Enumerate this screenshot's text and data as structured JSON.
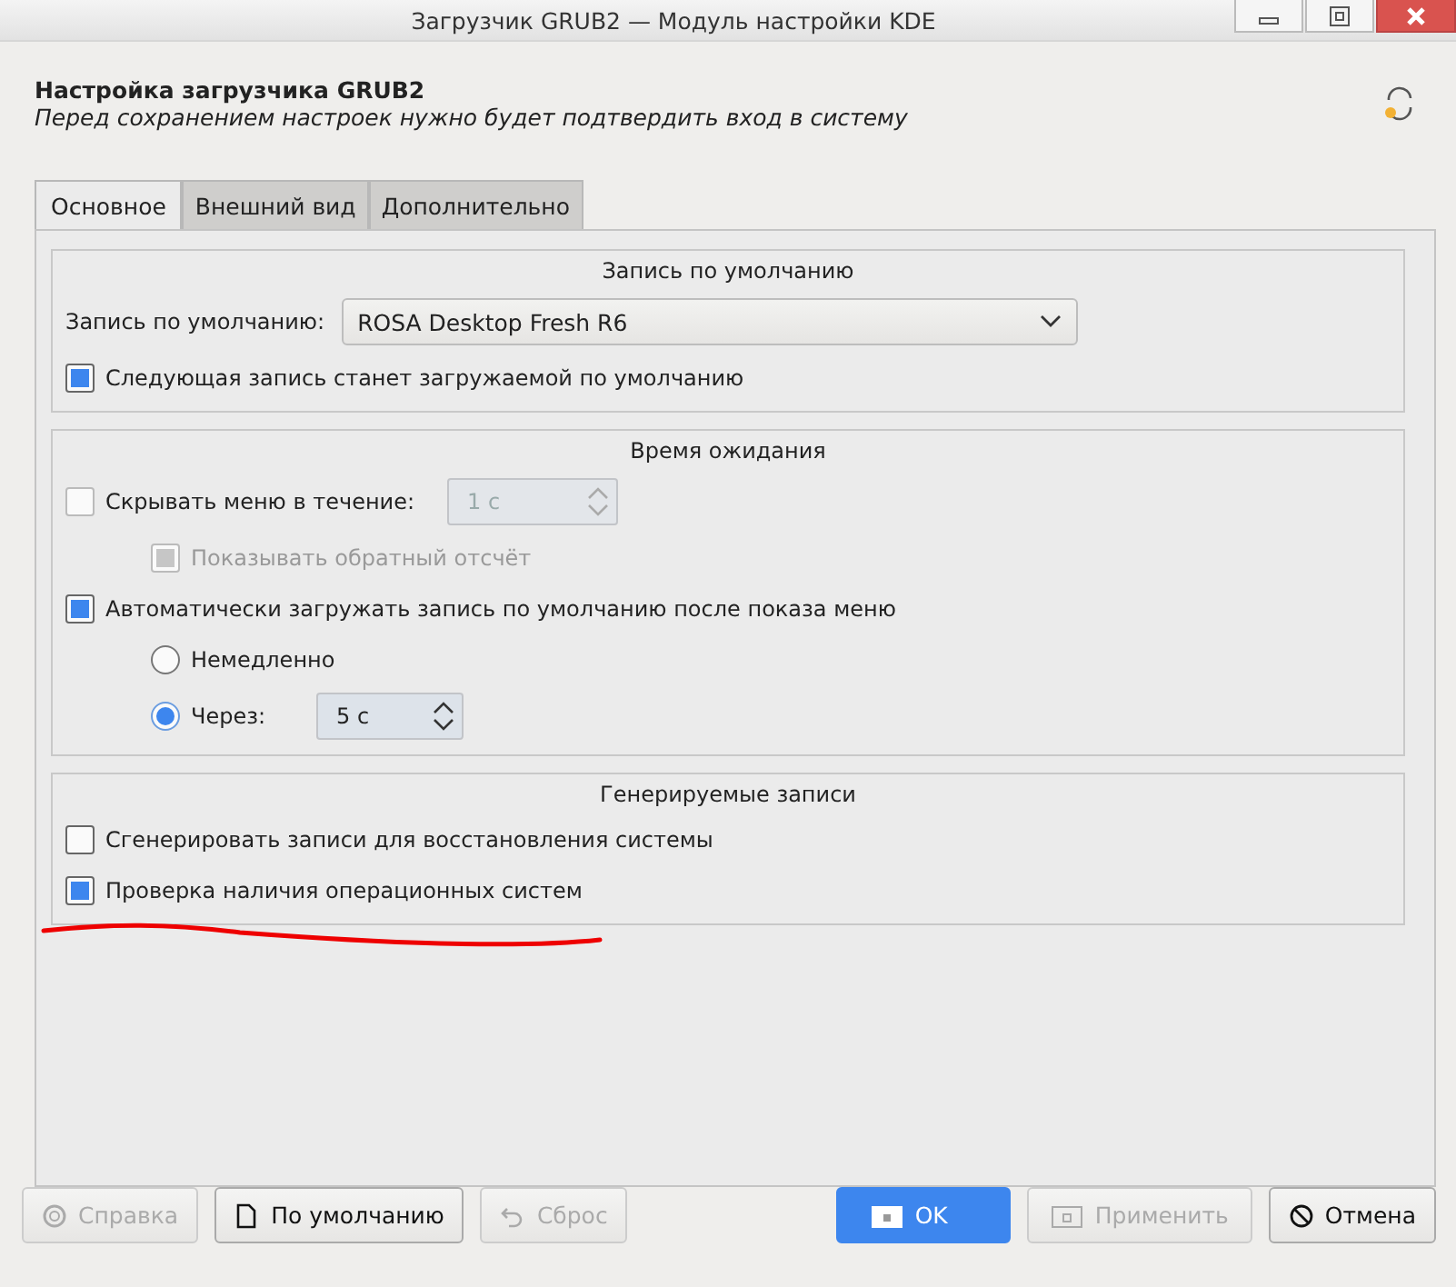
{
  "window": {
    "title": "Загрузчик GRUB2 — Модуль настройки KDE"
  },
  "header": {
    "title": "Настройка загрузчика GRUB2",
    "subtitle": "Перед сохранением настроек нужно будет подтвердить вход в систему"
  },
  "tabs": [
    {
      "label": "Основное",
      "selected": true
    },
    {
      "label": "Внешний вид",
      "selected": false
    },
    {
      "label": "Дополнительно",
      "selected": false
    }
  ],
  "groups": [
    {
      "title": "Запись по умолчанию",
      "rows": [
        {
          "kind": "combo",
          "label": "Запись по умолчанию:",
          "value": "ROSA Desktop Fresh R6"
        },
        {
          "kind": "checkbox",
          "label": "Следующая запись станет загружаемой по умолчанию",
          "checked": true,
          "disabled": false,
          "indented": false
        }
      ]
    },
    {
      "title": "Время ожидания",
      "rows": [
        {
          "kind": "checkspin",
          "label": "Скрывать меню в течение:",
          "checked": false,
          "value": "1 с",
          "disabled": true
        },
        {
          "kind": "checkbox",
          "label": "Показывать обратный отсчёт",
          "checked": true,
          "disabled": true,
          "indented": true
        },
        {
          "kind": "checkbox",
          "label": "Автоматически загружать запись по умолчанию после показа меню",
          "checked": true,
          "disabled": false,
          "indented": false
        },
        {
          "kind": "radio",
          "label": "Немедленно",
          "selected": false
        },
        {
          "kind": "radiospin",
          "label": "Через:",
          "selected": true,
          "value": "5 с",
          "disabled": false
        }
      ]
    },
    {
      "title": "Генерируемые записи",
      "rows": [
        {
          "kind": "checkbox",
          "label": "Сгенерировать записи для восстановления системы",
          "checked": false,
          "disabled": false,
          "indented": false
        },
        {
          "kind": "checkbox",
          "label": "Проверка наличия операционных систем",
          "checked": true,
          "disabled": false,
          "indented": false
        }
      ]
    }
  ],
  "buttons_left": [
    {
      "label": "Справка",
      "disabled": true
    },
    {
      "label": "По умолчанию",
      "disabled": false
    },
    {
      "label": "Сброс",
      "disabled": true
    }
  ],
  "buttons_right": [
    {
      "label": "OK",
      "disabled": false,
      "primary": true
    },
    {
      "label": "Применить",
      "disabled": true,
      "primary": false
    },
    {
      "label": "Отмена",
      "disabled": false,
      "primary": false
    }
  ]
}
